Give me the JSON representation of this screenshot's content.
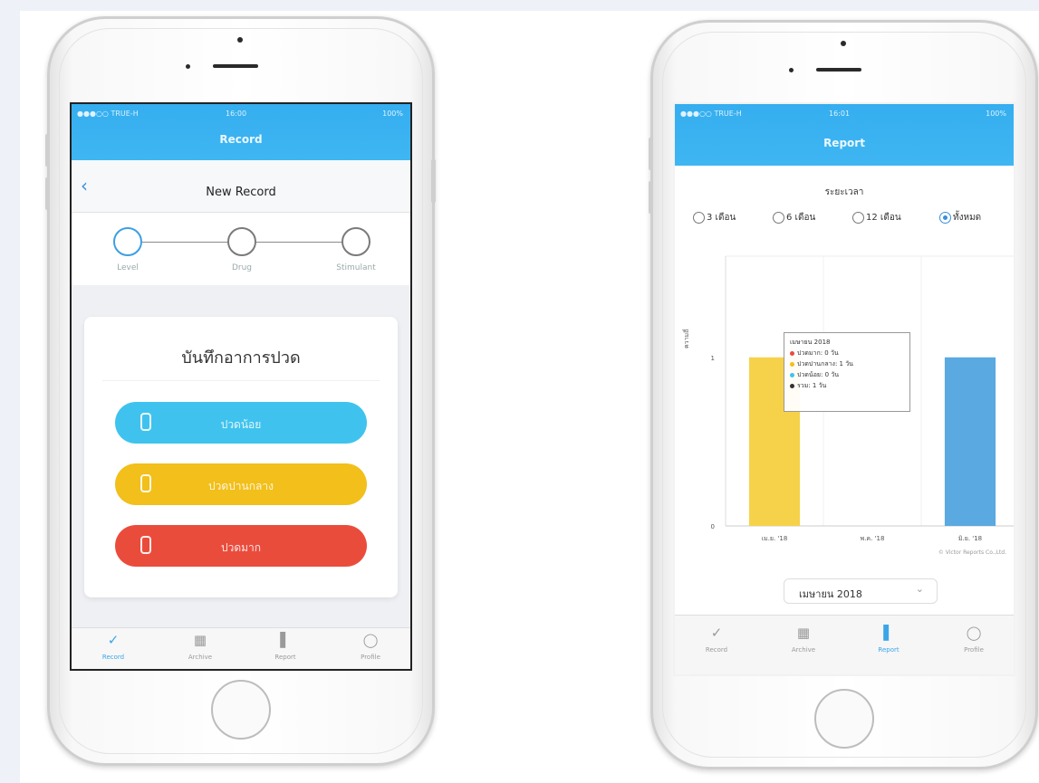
{
  "left_phone": {
    "appbar_title": "Record",
    "status": {
      "carrier": "●●●○○ TRUE-H",
      "time": "16:00",
      "battery": "100%"
    },
    "subbar_title": "New Record",
    "back_icon": "chevron-left-icon",
    "steps": [
      {
        "label": "Level",
        "active": true
      },
      {
        "label": "Drug",
        "active": false
      },
      {
        "label": "Stimulant",
        "active": false
      }
    ],
    "card_title": "บันทึกอาการปวด",
    "buttons": [
      {
        "label": "ปวดน้อย",
        "color": "#3fc3ee",
        "icon": "thermometer-icon"
      },
      {
        "label": "ปวดปานกลาง",
        "color": "#f2bf1b",
        "icon": "thermometer-icon"
      },
      {
        "label": "ปวดมาก",
        "color": "#ea4c3c",
        "icon": "thermometer-icon"
      }
    ],
    "tabs": [
      {
        "label": "Record",
        "icon": "check-circle-icon",
        "active": true
      },
      {
        "label": "Archive",
        "icon": "archive-icon",
        "active": false
      },
      {
        "label": "Report",
        "icon": "bar-chart-icon",
        "active": false
      },
      {
        "label": "Profile",
        "icon": "profile-icon",
        "active": false
      }
    ]
  },
  "right_phone": {
    "appbar_title": "Report",
    "status": {
      "carrier": "●●●○○ TRUE-H",
      "time": "16:01",
      "battery": "100%"
    },
    "period_title": "ระยะเวลา",
    "periods": [
      {
        "label": "3 เดือน",
        "selected": false
      },
      {
        "label": "6 เดือน",
        "selected": false
      },
      {
        "label": "12 เดือน",
        "selected": false
      },
      {
        "label": "ทั้งหมด",
        "selected": true
      }
    ],
    "tooltip": {
      "title": "เมษายน 2018",
      "rows": [
        {
          "text": "ปวดมาก: 0 วัน",
          "color": "#ea4c3c"
        },
        {
          "text": "ปวดปานกลาง: 1 วัน",
          "color": "#f2bf1b"
        },
        {
          "text": "ปวดน้อย: 0 วัน",
          "color": "#3fc3ee"
        },
        {
          "text": "รวม: 1 วัน",
          "color": "#333333"
        }
      ]
    },
    "credit": "© Victor Reports Co.,Ltd.",
    "month_select": "เมษายน 2018",
    "tabs": [
      {
        "label": "Record",
        "icon": "check-circle-icon",
        "active": false
      },
      {
        "label": "Archive",
        "icon": "archive-icon",
        "active": false
      },
      {
        "label": "Report",
        "icon": "bar-chart-icon",
        "active": true
      },
      {
        "label": "Profile",
        "icon": "profile-icon",
        "active": false
      }
    ]
  },
  "chart_data": {
    "type": "bar",
    "categories": [
      "เม.ย. '18",
      "พ.ค. '18",
      "มิ.ย. '18"
    ],
    "series": [
      {
        "values": [
          1,
          0,
          0
        ],
        "color": "#f6d24a"
      },
      {
        "values": [
          0,
          0,
          1
        ],
        "color": "#5aa9e0"
      }
    ],
    "ylabel": "ความถี่",
    "yticks": [
      "0",
      "1"
    ],
    "ylim": [
      0,
      1.6
    ],
    "grid": true
  }
}
